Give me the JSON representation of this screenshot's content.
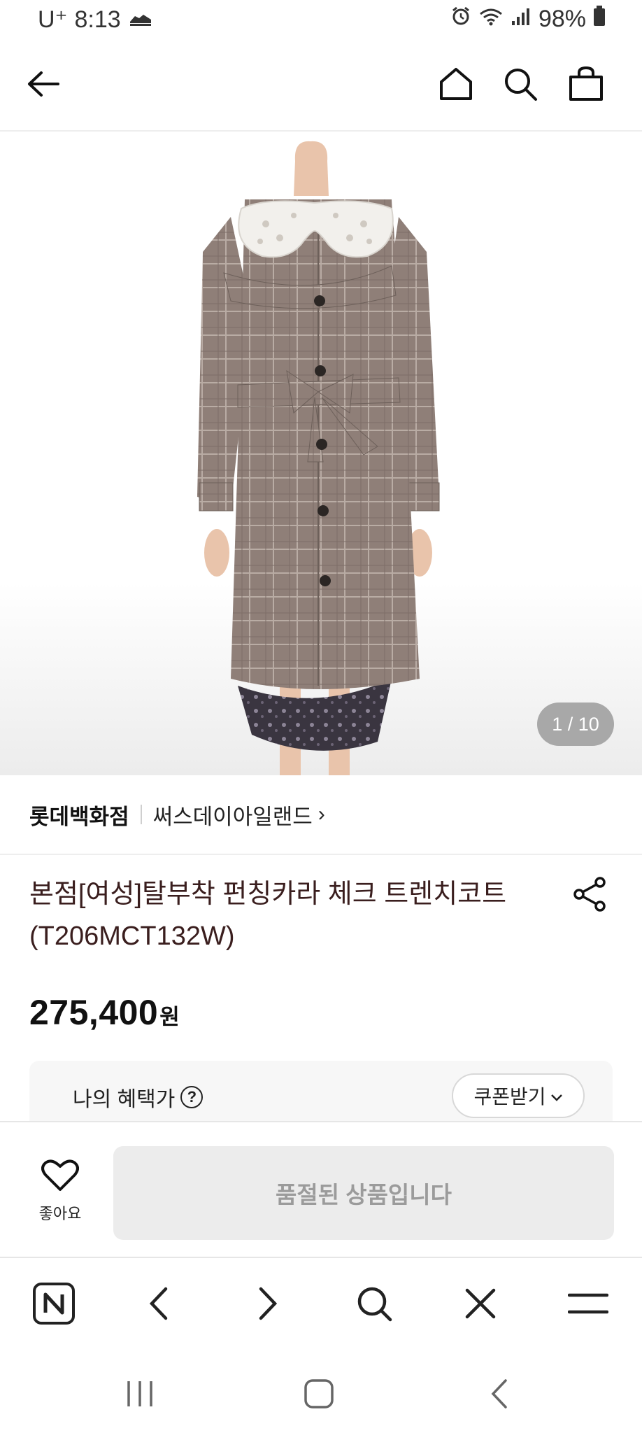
{
  "status_bar": {
    "carrier": "U⁺",
    "time": "8:13",
    "battery": "98%"
  },
  "icons": {
    "back": "back-arrow-icon",
    "home": "home-icon",
    "search": "search-icon",
    "cart": "shopping-bag-icon",
    "share": "share-icon",
    "like": "heart-icon"
  },
  "product_image": {
    "counter": "1 / 10"
  },
  "brand": {
    "store": "롯데백화점",
    "name": "써스데이아일랜드",
    "chevron": "›"
  },
  "product": {
    "title_line1": "본점[여성]탈부착 펀칭카라 체크 트렌치코트",
    "title_line2": "(T206MCT132W)",
    "price": "275,400",
    "price_unit": "원"
  },
  "benefit": {
    "label": "나의 혜택가",
    "help": "?",
    "coupon_button": "쿠폰받기"
  },
  "actions": {
    "like_label": "좋아요",
    "soldout_label": "품절된 상품입니다"
  },
  "colors": {
    "title": "#3a1e1e",
    "soldout_bg": "#ececec",
    "soldout_text": "#9b9b9b"
  }
}
